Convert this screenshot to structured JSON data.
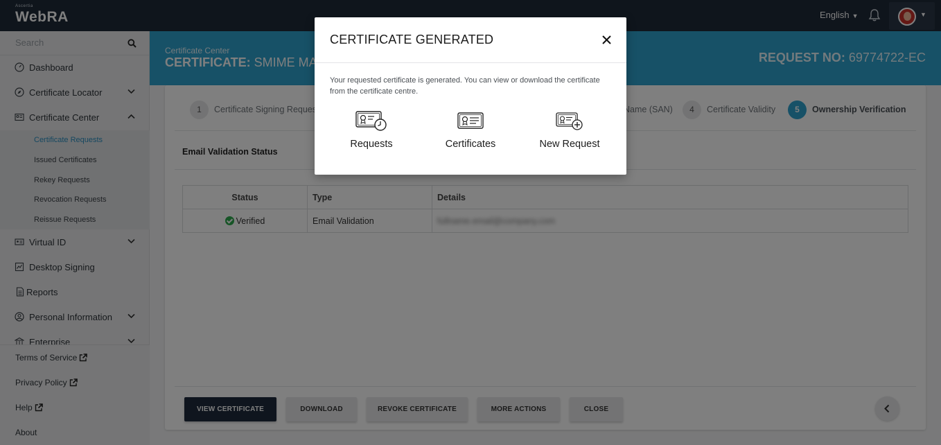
{
  "topbar": {
    "logo_small": "Ascertia",
    "logo": "WebRA",
    "language": "English"
  },
  "sidebar": {
    "search_placeholder": "Search",
    "items": [
      {
        "label": "Dashboard",
        "icon": "dashboard-icon"
      },
      {
        "label": "Certificate Locator",
        "icon": "compass-icon"
      },
      {
        "label": "Certificate Center",
        "icon": "certificate-icon"
      },
      {
        "label": "Virtual ID",
        "icon": "id-card-icon"
      },
      {
        "label": "Desktop Signing",
        "icon": "desktop-signing-icon"
      },
      {
        "label": "Reports",
        "icon": "report-icon"
      },
      {
        "label": "Personal Information",
        "icon": "user-circle-icon"
      },
      {
        "label": "Enterprise",
        "icon": "bank-icon"
      }
    ],
    "subitems": [
      "Certificate Requests",
      "Issued Certificates",
      "Rekey Requests",
      "Revocation Requests",
      "Reissue Requests"
    ],
    "footer": [
      "Terms of Service",
      "Privacy Policy",
      "Help",
      "About"
    ]
  },
  "header": {
    "breadcrumb": "Certificate Center",
    "title_prefix": "CERTIFICATE:",
    "title_value": "SMIME MAIL",
    "request_prefix": "REQUEST NO:",
    "request_no": "69774722-EC"
  },
  "steps": [
    {
      "num": "1",
      "label": "Certificate Signing Reques"
    },
    {
      "num": "",
      "label": "Name (SAN)"
    },
    {
      "num": "4",
      "label": "Certificate Validity"
    },
    {
      "num": "5",
      "label": "Ownership Verification"
    }
  ],
  "section": {
    "title": "Email Validation Status",
    "columns": [
      "Status",
      "Type",
      "Details"
    ],
    "row": {
      "status": "Verified",
      "type": "Email Validation",
      "details": "fullname.email@company.com"
    }
  },
  "actions": [
    "VIEW CERTIFICATE",
    "DOWNLOAD",
    "REVOKE CERTIFICATE",
    "MORE ACTIONS",
    "CLOSE"
  ],
  "modal": {
    "title": "CERTIFICATE GENERATED",
    "message": "Your requested certificate is generated. You can view or download the certificate from the certificate centre.",
    "options": [
      {
        "label": "Requests",
        "icon": "certificate-clock-icon"
      },
      {
        "label": "Certificates",
        "icon": "certificate-icon"
      },
      {
        "label": "New Request",
        "icon": "certificate-plus-icon"
      }
    ]
  },
  "colors": {
    "topbar": "#1f2a38",
    "accent": "#2fa3cf",
    "primary_button": "#1e2b3c",
    "verified": "#2eaa4f"
  }
}
